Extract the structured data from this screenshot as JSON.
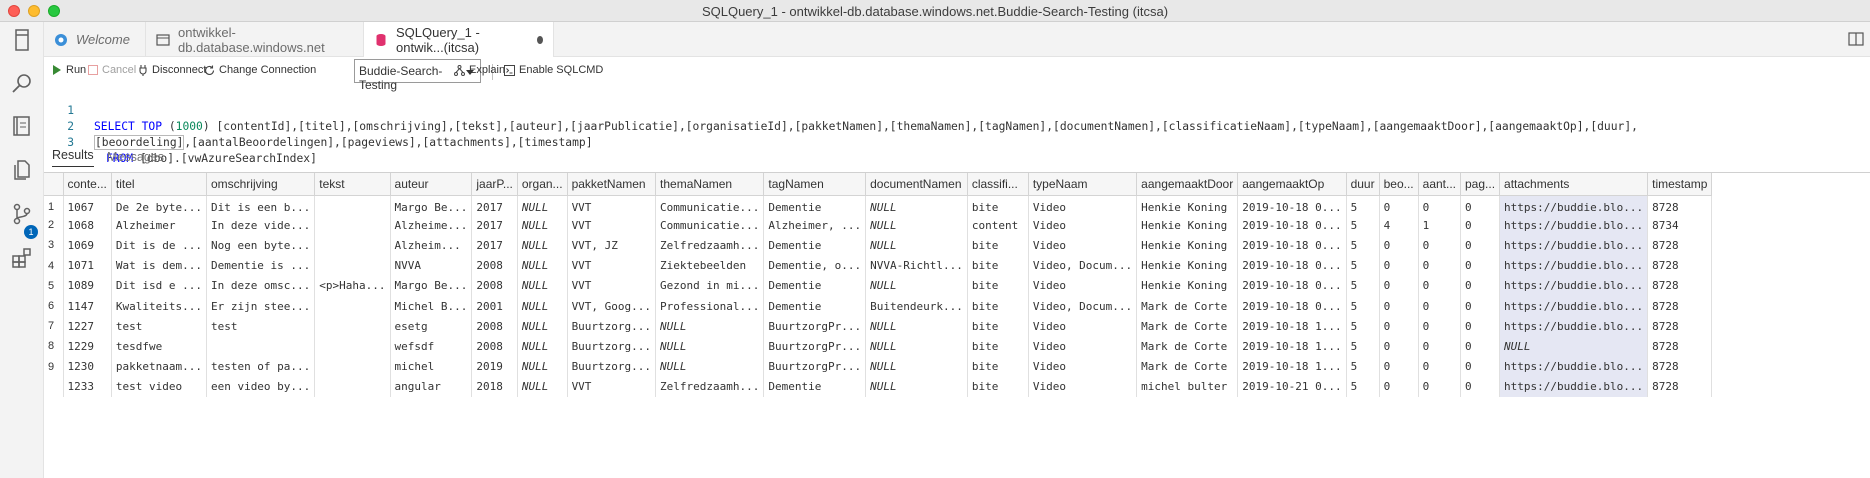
{
  "window": {
    "title": "SQLQuery_1 - ontwikkel-db.database.windows.net.Buddie-Search-Testing (itcsa)"
  },
  "tabs": [
    {
      "label": "Welcome"
    },
    {
      "label": "ontwikkel-db.database.windows.net"
    },
    {
      "label": "SQLQuery_1 - ontwik...(itcsa)"
    }
  ],
  "toolbar": {
    "run": "Run",
    "cancel": "Cancel",
    "disconnect": "Disconnect",
    "change_connection": "Change Connection",
    "database": "Buddie-Search-Testing",
    "explain": "Explain",
    "sqlcmd": "Enable SQLCMD"
  },
  "editor": {
    "line_numbers": [
      "1",
      "2",
      "3"
    ],
    "line1_kw1": "SELECT",
    "line1_kw2": "TOP",
    "line1_num": "1000",
    "line1_rest": "[contentId],[titel],[omschrijving],[tekst],[auteur],[jaarPublicatie],[organisatieId],[pakketNamen],[themaNamen],[tagNamen],[documentNamen],[classificatieNaam],[typeNaam],[aangemaaktDoor],[aangemaaktOp],[duur],",
    "line2_first": "[beoordeling]",
    "line2_rest": ",[aantalBeoordelingen],[pageviews],[attachments],[timestamp]",
    "line3_kw": "FROM",
    "line3_rest": "[dbo].[vwAzureSearchIndex]"
  },
  "results_tabs": {
    "results": "Results",
    "messages": "Messages"
  },
  "badge_count": "1",
  "grid": {
    "columns": [
      "conte...",
      "titel",
      "omschrijving",
      "tekst",
      "auteur",
      "jaarP...",
      "organ...",
      "pakketNamen",
      "themaNamen",
      "tagNamen",
      "documentNamen",
      "classifi...",
      "typeNaam",
      "aangemaaktDoor",
      "aangemaaktOp",
      "duur",
      "beo...",
      "aant...",
      "pag...",
      "attachments",
      "timestamp"
    ],
    "rows": [
      [
        "1",
        "1067",
        "De 2e byte...",
        "Dit is een b...",
        "",
        "Margo Be...",
        "2017",
        "NULL",
        "VVT",
        "Communicatie...",
        "Dementie",
        "NULL",
        "bite",
        "Video",
        "Henkie Koning",
        "2019-10-18 0...",
        "5",
        "0",
        "0",
        "0",
        "https://buddie.blo...",
        "8728"
      ],
      [
        "2",
        "1068",
        "Alzheimer",
        "In deze vide...",
        "",
        "Alzheime...",
        "2017",
        "NULL",
        "VVT",
        "Communicatie...",
        "Alzheimer, ...",
        "NULL",
        "content",
        "Video",
        "Henkie Koning",
        "2019-10-18 0...",
        "5",
        "4",
        "1",
        "0",
        "https://buddie.blo...",
        "8734"
      ],
      [
        "3",
        "1069",
        "Dit is de ...",
        "Nog een byte...",
        "",
        "Alzheim...",
        "2017",
        "NULL",
        "VVT, JZ",
        "Zelfredzaamh...",
        "Dementie",
        "NULL",
        "bite",
        "Video",
        "Henkie Koning",
        "2019-10-18 0...",
        "5",
        "0",
        "0",
        "0",
        "https://buddie.blo...",
        "8728"
      ],
      [
        "4",
        "1071",
        "Wat is dem...",
        "Dementie is ...",
        "",
        "NVVA",
        "2008",
        "NULL",
        "VVT",
        "Ziektebeelden",
        "Dementie, o...",
        "NVVA-Richtl...",
        "bite",
        "Video, Docum...",
        "Henkie Koning",
        "2019-10-18 0...",
        "5",
        "0",
        "0",
        "0",
        "https://buddie.blo...",
        "8728"
      ],
      [
        "5",
        "1089",
        "Dit isd e ...",
        "In deze omsc...",
        "<p>Haha...",
        "Margo Be...",
        "2008",
        "NULL",
        "VVT",
        "Gezond in mi...",
        "Dementie",
        "NULL",
        "bite",
        "Video",
        "Henkie Koning",
        "2019-10-18 0...",
        "5",
        "0",
        "0",
        "0",
        "https://buddie.blo...",
        "8728"
      ],
      [
        "6",
        "1147",
        "Kwaliteits...",
        "Er zijn stee...",
        "",
        "Michel B...",
        "2001",
        "NULL",
        "VVT, Goog...",
        "Professional...",
        "Dementie",
        "Buitendeurk...",
        "bite",
        "Video, Docum...",
        "Mark de Corte",
        "2019-10-18 0...",
        "5",
        "0",
        "0",
        "0",
        "https://buddie.blo...",
        "8728"
      ],
      [
        "7",
        "1227",
        "test",
        "test",
        "",
        "esetg",
        "2008",
        "NULL",
        "Buurtzorg...",
        "NULL",
        "BuurtzorgPr...",
        "NULL",
        "bite",
        "Video",
        "Mark de Corte",
        "2019-10-18 1...",
        "5",
        "0",
        "0",
        "0",
        "https://buddie.blo...",
        "8728"
      ],
      [
        "8",
        "1229",
        "tesdfwe",
        "",
        "",
        "wefsdf",
        "2008",
        "NULL",
        "Buurtzorg...",
        "NULL",
        "BuurtzorgPr...",
        "NULL",
        "bite",
        "Video",
        "Mark de Corte",
        "2019-10-18 1...",
        "5",
        "0",
        "0",
        "0",
        "NULL",
        "8728"
      ],
      [
        "9",
        "1230",
        "pakketnaam...",
        "testen of pa...",
        "",
        "michel",
        "2019",
        "NULL",
        "Buurtzorg...",
        "NULL",
        "BuurtzorgPr...",
        "NULL",
        "bite",
        "Video",
        "Mark de Corte",
        "2019-10-18 1...",
        "5",
        "0",
        "0",
        "0",
        "https://buddie.blo...",
        "8728"
      ],
      [
        "",
        "1233",
        "test video",
        "een video by...",
        "",
        "angular",
        "2018",
        "NULL",
        "VVT",
        "Zelfredzaamh...",
        "Dementie",
        "NULL",
        "bite",
        "Video",
        "michel bulter",
        "2019-10-21 0...",
        "5",
        "0",
        "0",
        "0",
        "https://buddie.blo...",
        "8728"
      ]
    ]
  }
}
